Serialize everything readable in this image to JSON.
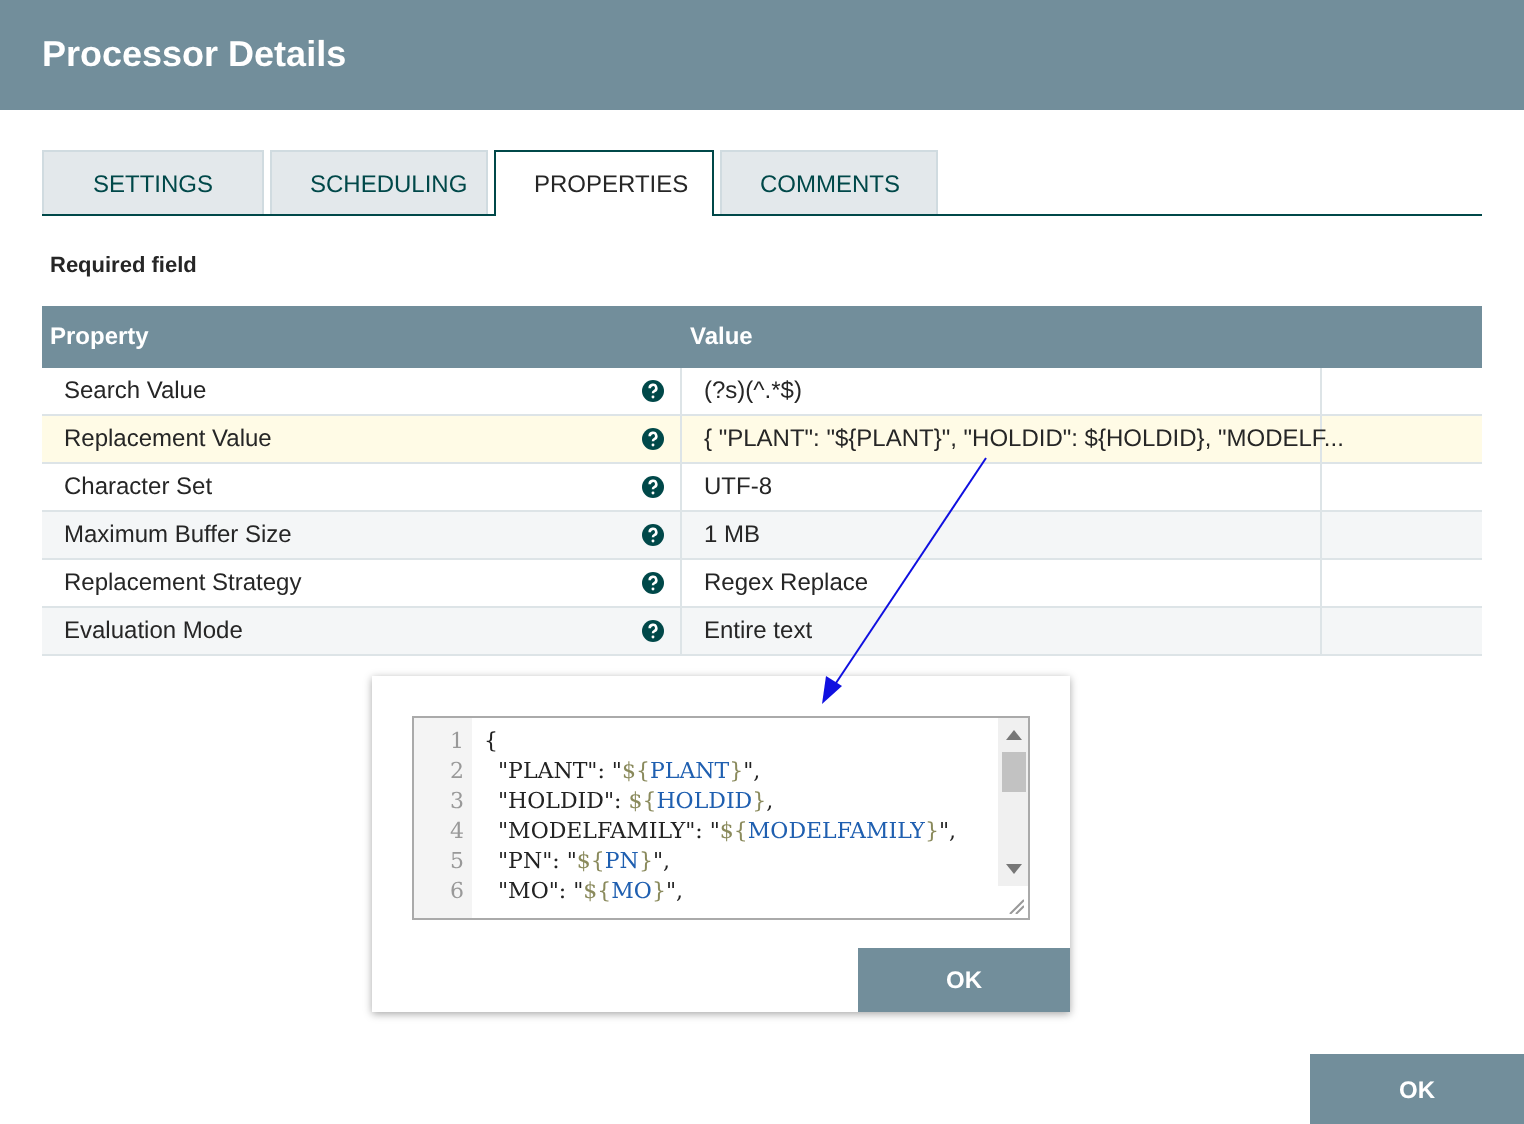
{
  "window": {
    "title": "Processor Details"
  },
  "tabs": [
    {
      "label": "SETTINGS",
      "selected": false
    },
    {
      "label": "SCHEDULING",
      "selected": false
    },
    {
      "label": "PROPERTIES",
      "selected": true
    },
    {
      "label": "COMMENTS",
      "selected": false
    }
  ],
  "required_label": "Required field",
  "table": {
    "columns": [
      "Property",
      "Value"
    ],
    "rows": [
      {
        "property": "Search Value",
        "value": "(?s)(^.*$)",
        "selected": false
      },
      {
        "property": "Replacement Value",
        "value": "{ \"PLANT\": \"${PLANT}\", \"HOLDID\": ${HOLDID}, \"MODELF...",
        "selected": true
      },
      {
        "property": "Character Set",
        "value": "UTF-8",
        "selected": false
      },
      {
        "property": "Maximum Buffer Size",
        "value": "1 MB",
        "selected": false
      },
      {
        "property": "Replacement Strategy",
        "value": "Regex Replace",
        "selected": false
      },
      {
        "property": "Evaluation Mode",
        "value": "Entire text",
        "selected": false
      }
    ]
  },
  "editor": {
    "lines": [
      {
        "number": "1",
        "segments": [
          {
            "kind": "plain",
            "text": "{"
          }
        ]
      },
      {
        "number": "2",
        "segments": [
          {
            "kind": "plain",
            "text": "  \"PLANT\": \""
          },
          {
            "kind": "brace",
            "text": "${"
          },
          {
            "kind": "var",
            "text": "PLANT"
          },
          {
            "kind": "brace",
            "text": "}"
          },
          {
            "kind": "plain",
            "text": "\","
          }
        ]
      },
      {
        "number": "3",
        "segments": [
          {
            "kind": "plain",
            "text": "  \"HOLDID\": "
          },
          {
            "kind": "brace",
            "text": "${"
          },
          {
            "kind": "var",
            "text": "HOLDID"
          },
          {
            "kind": "brace",
            "text": "}"
          },
          {
            "kind": "plain",
            "text": ","
          }
        ]
      },
      {
        "number": "4",
        "segments": [
          {
            "kind": "plain",
            "text": "  \"MODELFAMILY\": \""
          },
          {
            "kind": "brace",
            "text": "${"
          },
          {
            "kind": "var",
            "text": "MODELFAMILY"
          },
          {
            "kind": "brace",
            "text": "}"
          },
          {
            "kind": "plain",
            "text": "\","
          }
        ]
      },
      {
        "number": "5",
        "segments": [
          {
            "kind": "plain",
            "text": "  \"PN\": \""
          },
          {
            "kind": "brace",
            "text": "${"
          },
          {
            "kind": "var",
            "text": "PN"
          },
          {
            "kind": "brace",
            "text": "}"
          },
          {
            "kind": "plain",
            "text": "\","
          }
        ]
      },
      {
        "number": "6",
        "segments": [
          {
            "kind": "plain",
            "text": "  \"MO\": \""
          },
          {
            "kind": "brace",
            "text": "${"
          },
          {
            "kind": "var",
            "text": "MO"
          },
          {
            "kind": "brace",
            "text": "}"
          },
          {
            "kind": "plain",
            "text": "\","
          }
        ]
      }
    ],
    "ok_label": "OK"
  },
  "footer": {
    "ok_label": "OK"
  }
}
